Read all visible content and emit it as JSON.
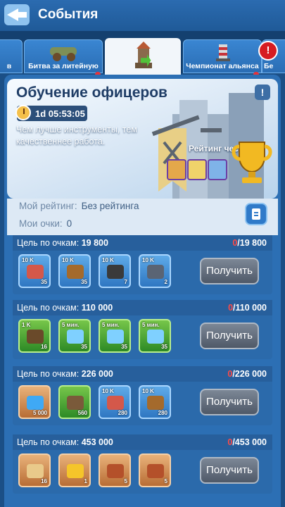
{
  "header": {
    "title": "События"
  },
  "tabs": [
    {
      "label": "в",
      "active": false,
      "dot": false
    },
    {
      "label": "Битва за литейную",
      "active": false,
      "dot": true
    },
    {
      "label": "",
      "active": true,
      "dot": false
    },
    {
      "label": "Чемпионат альянса",
      "active": false,
      "dot": true
    },
    {
      "label": "Бе",
      "active": false,
      "dot": false
    }
  ],
  "banner": {
    "title": "Обучение офицеров",
    "help": "!",
    "timer": "1d 05:53:05",
    "description": "Чем лучше инструменты, тем качественнее работа.",
    "honor_label": "Рейтинг чести"
  },
  "my": {
    "rank_label": "Мой рейтинг:",
    "rank_value": "Без рейтинга",
    "points_label": "Мои очки:",
    "points_value": "0"
  },
  "goals": [
    {
      "label": "Цель по очкам:",
      "target": "19 800",
      "current": "0",
      "total": "/19 800",
      "button": "Получить",
      "items": [
        {
          "top": "10 K",
          "count": "35",
          "kind": "blue",
          "icon": "meat"
        },
        {
          "top": "10 K",
          "count": "35",
          "kind": "blue",
          "icon": "wood"
        },
        {
          "top": "10 K",
          "count": "7",
          "kind": "blue",
          "icon": "coal"
        },
        {
          "top": "10 K",
          "count": "2",
          "kind": "blue",
          "icon": "iron"
        }
      ]
    },
    {
      "label": "Цель по очкам:",
      "target": "110 000",
      "current": "0",
      "total": "/110 000",
      "button": "Получить",
      "items": [
        {
          "top": "1 K",
          "count": "16",
          "kind": "green",
          "icon": "bottle"
        },
        {
          "top": "5 мин.",
          "count": "35",
          "kind": "green",
          "icon": "speedup"
        },
        {
          "top": "5 мин.",
          "count": "35",
          "kind": "green",
          "icon": "speedup"
        },
        {
          "top": "5 мин.",
          "count": "35",
          "kind": "green",
          "icon": "speedup"
        }
      ]
    },
    {
      "label": "Цель по очкам:",
      "target": "226 000",
      "current": "0",
      "total": "/226 000",
      "button": "Получить",
      "items": [
        {
          "top": "",
          "count": "5 000",
          "kind": "orange",
          "icon": "gem"
        },
        {
          "top": "",
          "count": "560",
          "kind": "green",
          "icon": "chest"
        },
        {
          "top": "10 K",
          "count": "280",
          "kind": "blue",
          "icon": "meat"
        },
        {
          "top": "10 K",
          "count": "280",
          "kind": "blue",
          "icon": "wood"
        }
      ]
    },
    {
      "label": "Цель по очкам:",
      "target": "453 000",
      "current": "0",
      "total": "/453 000",
      "button": "Получить",
      "items": [
        {
          "top": "",
          "count": "16",
          "kind": "orange",
          "icon": "scroll"
        },
        {
          "top": "",
          "count": "1",
          "kind": "orange",
          "icon": "gold-card"
        },
        {
          "top": "",
          "count": "5",
          "kind": "orange",
          "icon": "book"
        },
        {
          "top": "",
          "count": "5",
          "kind": "orange",
          "icon": "book"
        }
      ]
    }
  ],
  "colors": {
    "accent": "#2c6fb4",
    "progress_red": "#ff4a46",
    "button_gray": "#5f6a79"
  }
}
